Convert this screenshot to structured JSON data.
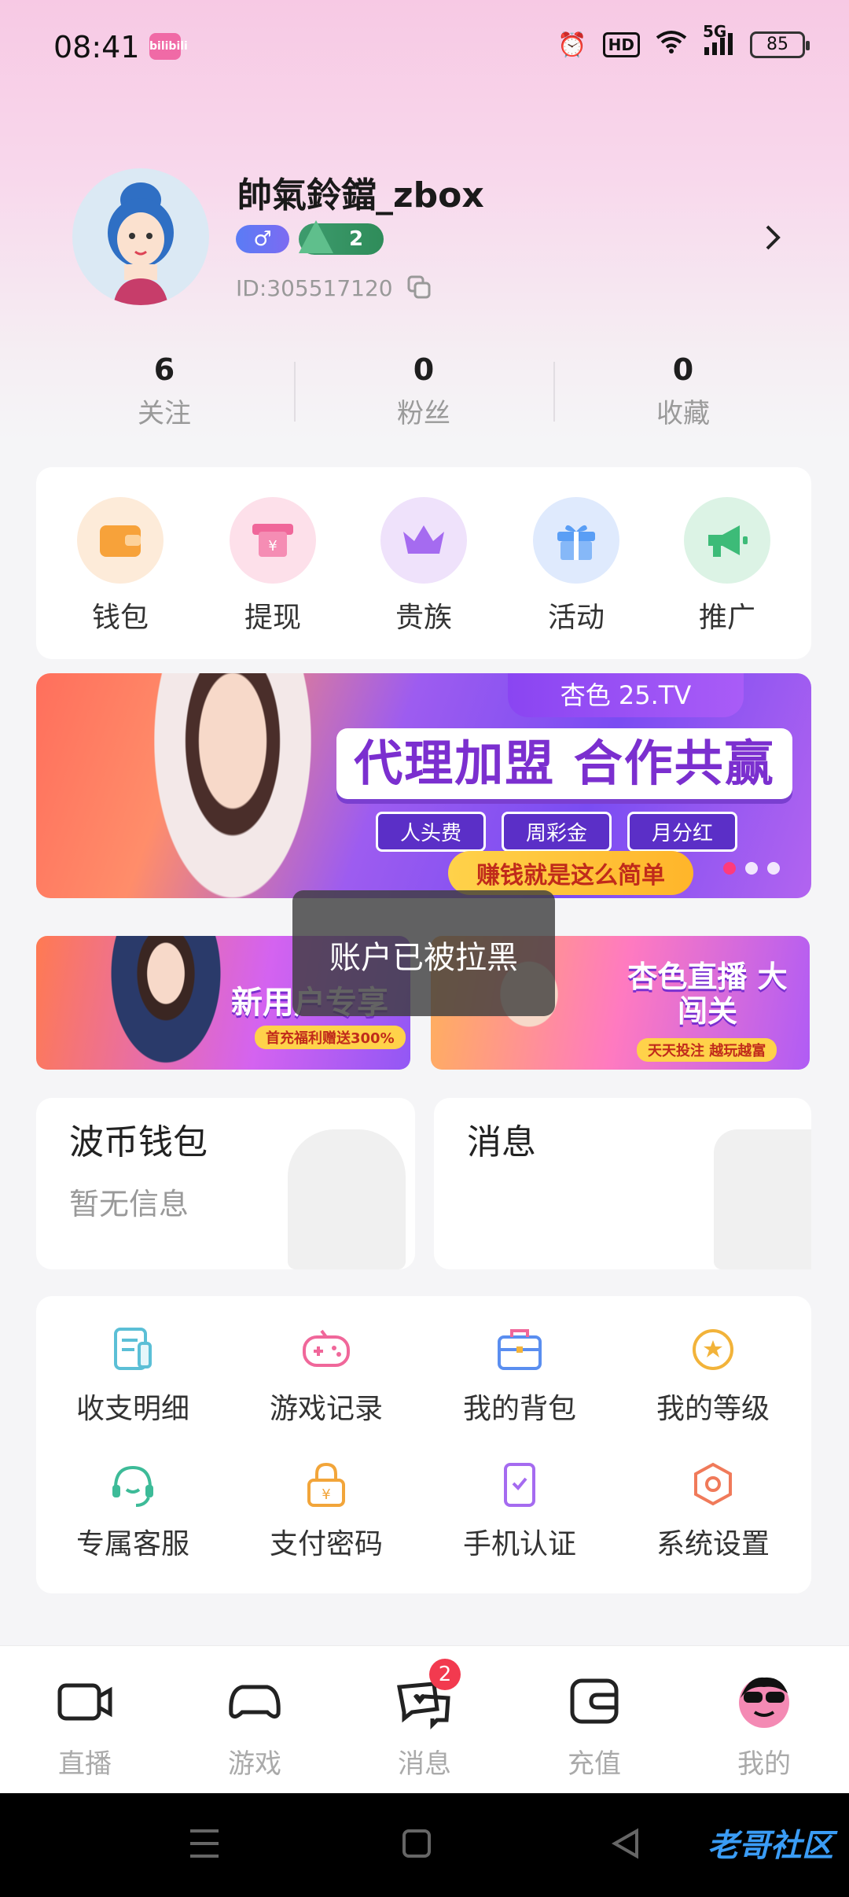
{
  "status_bar": {
    "time": "08:41",
    "app_mini": "bilibili",
    "hd": "HD",
    "network": "5G",
    "battery": "85"
  },
  "profile": {
    "name": "帥氣鈴鐺_zbox",
    "gender_symbol": "♂",
    "level": "2",
    "id": "ID:305517120"
  },
  "stats": [
    {
      "value": "6",
      "label": "关注"
    },
    {
      "value": "0",
      "label": "粉丝"
    },
    {
      "value": "0",
      "label": "收藏"
    }
  ],
  "quick_actions": [
    {
      "label": "钱包",
      "icon": "wallet-icon",
      "color": "#f7a23a"
    },
    {
      "label": "提现",
      "icon": "withdraw-icon",
      "color": "#f0679a"
    },
    {
      "label": "贵族",
      "icon": "crown-icon",
      "color": "#a56bf0"
    },
    {
      "label": "活动",
      "icon": "gift-icon",
      "color": "#5a9ef5"
    },
    {
      "label": "推广",
      "icon": "megaphone-icon",
      "color": "#3dbb78"
    }
  ],
  "banner": {
    "brand": "杏色 25.TV",
    "title": "代理加盟 合作共赢",
    "tags": [
      "人头费",
      "周彩金",
      "月分红"
    ],
    "slogan": "赚钱就是这么简单"
  },
  "sub_banners": [
    {
      "title": "新用户专享",
      "sub": "首充福利赠送300%"
    },
    {
      "title": "杏色直播 大闯关",
      "sub": "天天投注 越玩越富"
    }
  ],
  "toast": "账户已被拉黑",
  "wallet_card": {
    "title": "波币钱包",
    "desc": "暂无信息"
  },
  "message_card": {
    "title": "消息"
  },
  "menu_grid": [
    {
      "label": "收支明细",
      "icon": "bill-icon",
      "color": "#5bbfd6"
    },
    {
      "label": "游戏记录",
      "icon": "gamepad-icon",
      "color": "#f0679a"
    },
    {
      "label": "我的背包",
      "icon": "bag-icon",
      "color": "#5a8ef0"
    },
    {
      "label": "我的等级",
      "icon": "star-badge-icon",
      "color": "#f2b33a"
    },
    {
      "label": "专属客服",
      "icon": "headset-icon",
      "color": "#3dbb98"
    },
    {
      "label": "支付密码",
      "icon": "lock-icon",
      "color": "#f2a53a"
    },
    {
      "label": "手机认证",
      "icon": "phone-check-icon",
      "color": "#a56bf0"
    },
    {
      "label": "系统设置",
      "icon": "settings-hex-icon",
      "color": "#f07a5a"
    }
  ],
  "bottom_nav": [
    {
      "label": "直播",
      "icon": "camera-icon"
    },
    {
      "label": "游戏",
      "icon": "gamepad-nav-icon"
    },
    {
      "label": "消息",
      "icon": "chat-icon",
      "badge": "2"
    },
    {
      "label": "充值",
      "icon": "recharge-icon"
    },
    {
      "label": "我的",
      "icon": "avatar-icon"
    }
  ],
  "watermark": "老哥社区"
}
